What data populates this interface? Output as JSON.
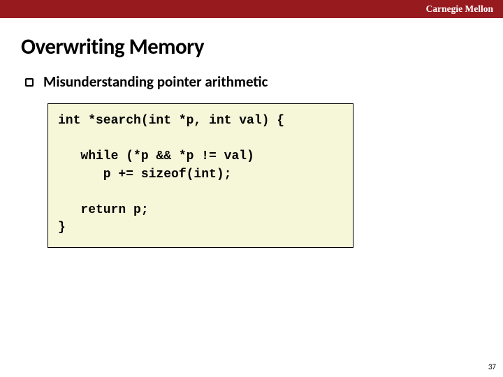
{
  "header": {
    "institution": "Carnegie Mellon"
  },
  "title": "Overwriting Memory",
  "bullet": {
    "text": "Misunderstanding pointer arithmetic"
  },
  "code": "int *search(int *p, int val) {\n\n   while (*p && *p != val)\n      p += sizeof(int);\n\n   return p;\n}",
  "page_number": "37"
}
